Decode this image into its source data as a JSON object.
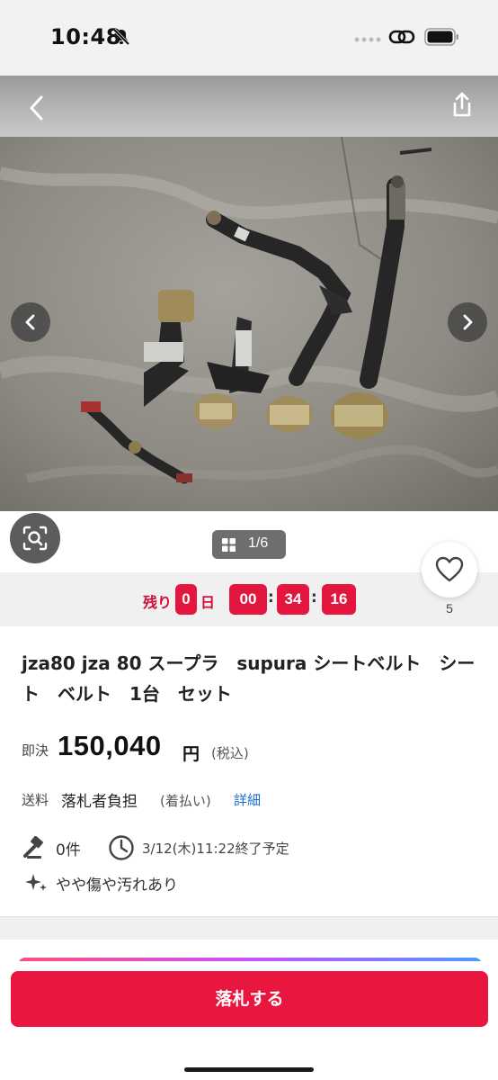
{
  "status_bar": {
    "time": "10:48"
  },
  "photo": {
    "counter": "1/6"
  },
  "countdown": {
    "remaining_label": "残り",
    "days": "0",
    "days_unit": "日",
    "hours": "00",
    "minutes": "34",
    "seconds": "16"
  },
  "favorite": {
    "count": "5"
  },
  "item": {
    "title": "jza80 jza 80 スープラ　supura シートベルト　シート　ベルト　1台　セット",
    "price_label": "即決",
    "price_value": "150,040",
    "price_unit": "円",
    "price_tax": "(税込)",
    "shipping_label": "送料",
    "shipping_value": "落札者負担",
    "shipping_note": "(着払い)",
    "shipping_link": "詳細",
    "bids": "0件",
    "end_time": "3/12(木)11:22終了予定",
    "condition": "やや傷や汚れあり"
  },
  "actions": {
    "bid_button": "落札する"
  },
  "colors": {
    "accent": "#e9173f",
    "link": "#1a6fd1",
    "countdown_box": "#e2163f"
  },
  "icons": [
    "bell-slash-icon",
    "link-icon",
    "battery-icon",
    "back-icon",
    "share-icon",
    "chevron-left-icon",
    "chevron-right-icon",
    "image-search-icon",
    "grid-icon",
    "heart-icon",
    "gavel-icon",
    "clock-icon",
    "sparkle-icon"
  ]
}
